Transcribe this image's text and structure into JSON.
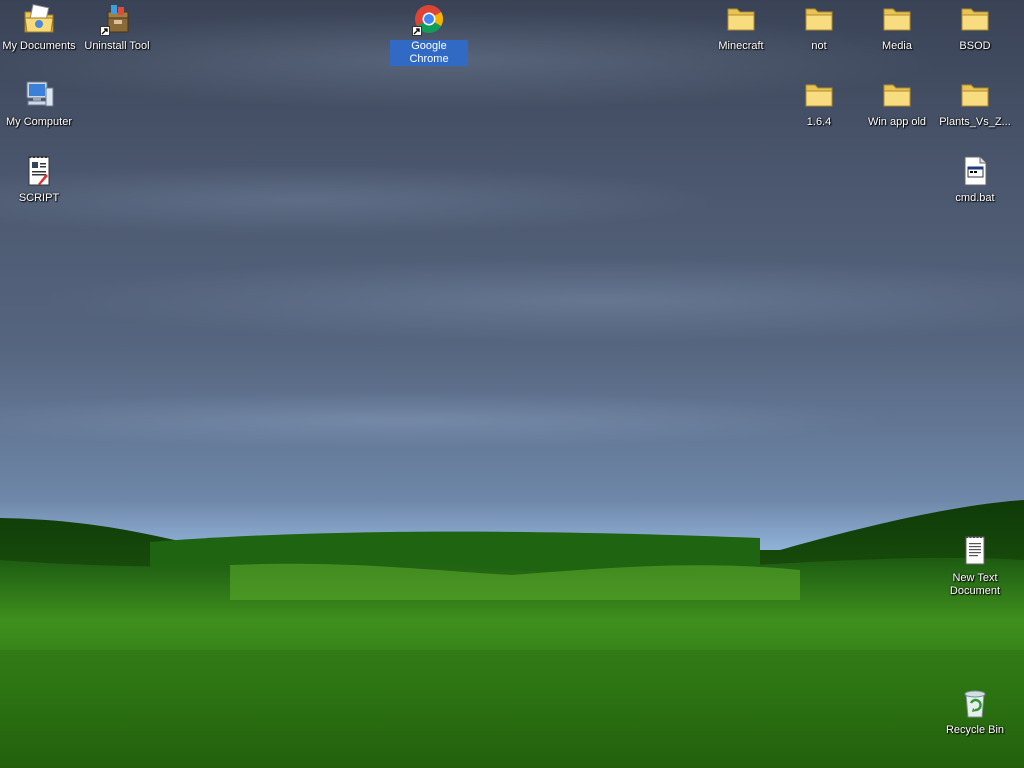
{
  "icons": [
    {
      "label": "My Documents",
      "icon": "my-documents-icon"
    },
    {
      "label": "Uninstall Tool",
      "icon": "uninstall-tool-icon"
    },
    {
      "label": "Google Chrome",
      "icon": "chrome-icon"
    },
    {
      "label": "Minecraft",
      "icon": "folder-icon"
    },
    {
      "label": "not",
      "icon": "folder-icon"
    },
    {
      "label": "Media",
      "icon": "folder-icon"
    },
    {
      "label": "BSOD",
      "icon": "folder-icon"
    },
    {
      "label": "My Computer",
      "icon": "my-computer-icon"
    },
    {
      "label": "1.6.4",
      "icon": "folder-icon"
    },
    {
      "label": "Win app old",
      "icon": "folder-icon"
    },
    {
      "label": "Plants_Vs_Z...",
      "icon": "folder-icon"
    },
    {
      "label": "SCRIPT",
      "icon": "document-icon"
    },
    {
      "label": "cmd.bat",
      "icon": "batch-file-icon"
    },
    {
      "label": "New Text Document",
      "icon": "text-document-icon"
    },
    {
      "label": "Recycle Bin",
      "icon": "recycle-bin-icon"
    }
  ],
  "selected_icon": "Google Chrome",
  "colors": {
    "selection": "#316ac5",
    "folder": "#f5d76e"
  }
}
